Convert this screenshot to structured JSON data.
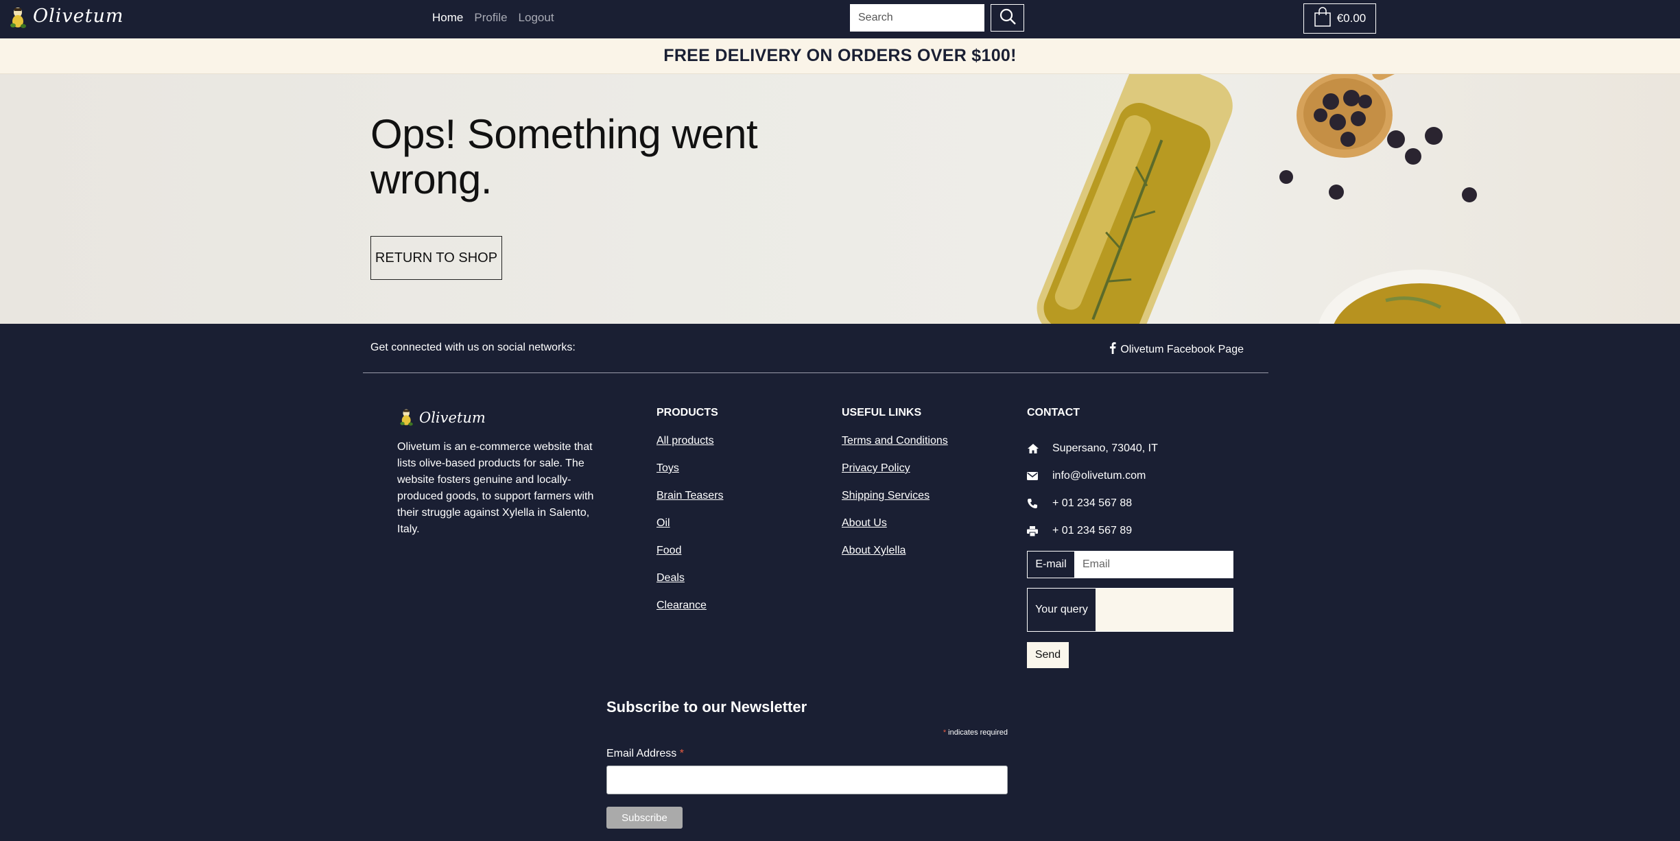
{
  "navbar": {
    "brand": "Olivetum",
    "links": [
      "Home",
      "Profile",
      "Logout"
    ],
    "search_placeholder": "Search",
    "cart_total": "€0.00"
  },
  "promo": {
    "text": "FREE DELIVERY ON ORDERS OVER $100!"
  },
  "hero": {
    "title": "Ops! Something went wrong.",
    "button": "RETURN TO SHOP"
  },
  "social": {
    "text": "Get connected with us on social networks:",
    "facebook_label": "Olivetum Facebook Page"
  },
  "footer": {
    "brand": "Olivetum",
    "about": "Olivetum is an e-commerce website that lists olive-based products for sale. The website fosters genuine and locally-produced goods, to support farmers with their struggle against Xylella in Salento, Italy.",
    "products": {
      "heading": "PRODUCTS",
      "items": [
        "All products",
        "Toys",
        "Brain Teasers",
        "Oil",
        "Food",
        "Deals",
        "Clearance"
      ]
    },
    "useful_links": {
      "heading": "USEFUL LINKS",
      "items": [
        "Terms and Conditions",
        "Privacy Policy",
        "Shipping Services",
        "About Us",
        "About Xylella"
      ]
    },
    "contact": {
      "heading": "CONTACT",
      "address": "Supersano, 73040, IT",
      "email": "info@olivetum.com",
      "phone": "+ 01 234 567 88",
      "fax": "+ 01 234 567 89",
      "email_label": "E-mail",
      "email_placeholder": "Email",
      "query_label": "Your query",
      "send": "Send"
    }
  },
  "newsletter": {
    "title": "Subscribe to our Newsletter",
    "required_star": "*",
    "required_note": "indicates required",
    "email_label": "Email Address",
    "subscribe": "Subscribe"
  },
  "colors": {
    "dark": "#1a1f33",
    "cream": "#faf4e8",
    "required": "#e85c41"
  }
}
